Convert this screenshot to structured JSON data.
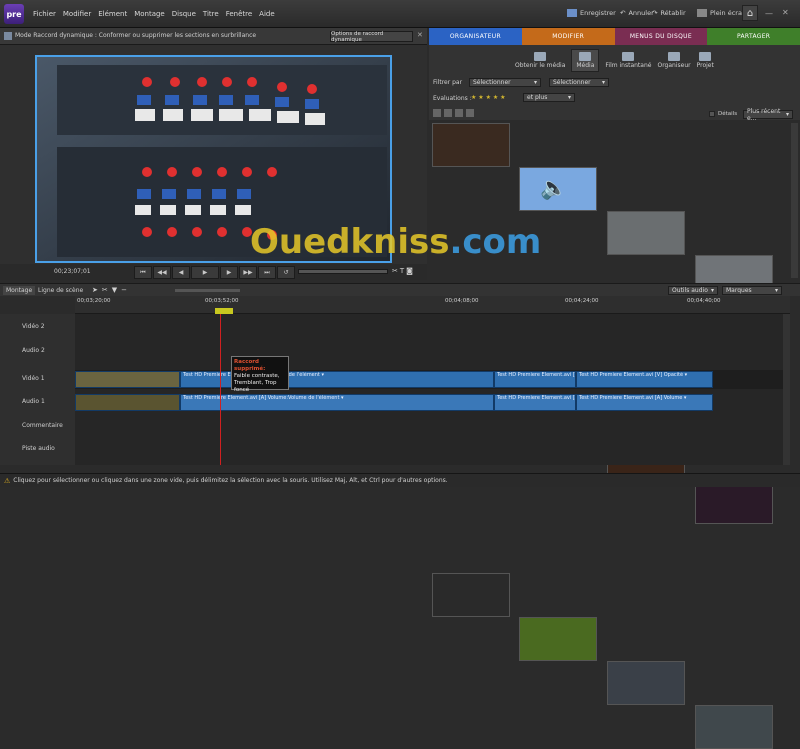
{
  "app": {
    "logo": "pre"
  },
  "menu": {
    "items": [
      "Fichier",
      "Modifier",
      "Elément",
      "Montage",
      "Disque",
      "Titre",
      "Fenêtre",
      "Aide"
    ]
  },
  "topbar": {
    "save_label": "Enregistrer",
    "undo_label": "Annuler",
    "redo_label": "Rétablir",
    "fullscreen_label": "Plein écran"
  },
  "monitor": {
    "header_text": "Mode Raccord dynamique : Conformer ou supprimer les sections en surbrillance",
    "options_label": "Options de raccord dynamique",
    "timecode": "00;23;07;01"
  },
  "tabs": [
    {
      "label": "ORGANISATEUR",
      "color": "#2b63c4"
    },
    {
      "label": "MODIFIER",
      "color": "#c46a1a"
    },
    {
      "label": "MENUS DU DISQUE",
      "color": "#7a2d52"
    },
    {
      "label": "PARTAGER",
      "color": "#3f7f2a"
    }
  ],
  "right_tools": [
    "Obtenir le média",
    "Média",
    "Film instantané",
    "Organiseur",
    "Projet"
  ],
  "filters": {
    "filter_label": "Filtrer par",
    "select1": "Sélectionner",
    "select2": "Sélectionner",
    "ratings_label": "Evaluations :",
    "ratings_stars": "★ ★ ★ ★ ★",
    "ratings_select": "et plus",
    "details_label": "Détails",
    "sort_select": "Plus récent e..."
  },
  "timeline": {
    "tab_montage": "Montage",
    "tab_scenario": "Ligne de scène",
    "audio_tools": "Outils audio",
    "markers": "Marques",
    "ruler": [
      "00;03;20;00",
      "00;03;52;00",
      "00;04;08;00",
      "00;04;24;00",
      "00;04;40;00"
    ],
    "tracks": [
      "Vidéo 2",
      "Audio 2",
      "Vidéo 1",
      "Audio 1",
      "Commentaire",
      "Piste audio"
    ],
    "clip_label_a": "Test HD Premiere Element.avi [V] Opacité de l'élément ▾",
    "clip_label_b": "Test HD Premiere Element.avi [A] Volume:Volume de l'élément ▾",
    "clip_label_c": "Test HD Premiere Element.avi [V] Opacité ▾",
    "clip_label_d": "Test HD Premiere Element.avi [A] Volume ▾"
  },
  "tooltip": {
    "title": "Raccord supprimé:",
    "body": "Faible contraste, Tremblant, Trop foncé"
  },
  "status": {
    "text": "Cliquez pour sélectionner ou cliquez dans une zone vide, puis délimitez la sélection avec la souris. Utilisez Maj, Alt, et Ctrl pour d'autres options."
  },
  "watermark": {
    "main": "Ouedkniss",
    "dotcom": ".com"
  }
}
